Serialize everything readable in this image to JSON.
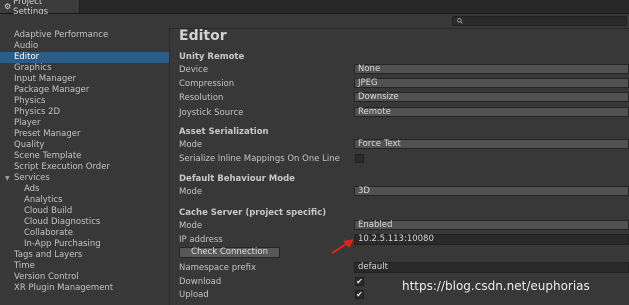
{
  "window": {
    "tab_title": "Project Settings"
  },
  "toolbar": {
    "search_icon": "search-icon"
  },
  "sidebar": {
    "items": [
      {
        "label": "Adaptive Performance",
        "indent": 0
      },
      {
        "label": "Audio",
        "indent": 0
      },
      {
        "label": "Editor",
        "indent": 0,
        "selected": true
      },
      {
        "label": "Graphics",
        "indent": 0
      },
      {
        "label": "Input Manager",
        "indent": 0
      },
      {
        "label": "Package Manager",
        "indent": 0
      },
      {
        "label": "Physics",
        "indent": 0
      },
      {
        "label": "Physics 2D",
        "indent": 0
      },
      {
        "label": "Player",
        "indent": 0
      },
      {
        "label": "Preset Manager",
        "indent": 0
      },
      {
        "label": "Quality",
        "indent": 0
      },
      {
        "label": "Scene Template",
        "indent": 0
      },
      {
        "label": "Script Execution Order",
        "indent": 0
      },
      {
        "label": "Services",
        "indent": 0,
        "foldout": true
      },
      {
        "label": "Ads",
        "indent": 1
      },
      {
        "label": "Analytics",
        "indent": 1
      },
      {
        "label": "Cloud Build",
        "indent": 1
      },
      {
        "label": "Cloud Diagnostics",
        "indent": 1
      },
      {
        "label": "Collaborate",
        "indent": 1
      },
      {
        "label": "In-App Purchasing",
        "indent": 1
      },
      {
        "label": "Tags and Layers",
        "indent": 0
      },
      {
        "label": "Time",
        "indent": 0
      },
      {
        "label": "Version Control",
        "indent": 0
      },
      {
        "label": "XR Plugin Management",
        "indent": 0
      }
    ]
  },
  "editor": {
    "title": "Editor",
    "unity_remote": {
      "header": "Unity Remote",
      "device_label": "Device",
      "device_value": "None",
      "compression_label": "Compression",
      "compression_value": "JPEG",
      "resolution_label": "Resolution",
      "resolution_value": "Downsize",
      "joystick_label": "Joystick Source",
      "joystick_value": "Remote"
    },
    "asset_serialization": {
      "header": "Asset Serialization",
      "mode_label": "Mode",
      "mode_value": "Force Text",
      "inline_label": "Serialize Inline Mappings On One Line",
      "inline_checked": false
    },
    "default_behaviour": {
      "header": "Default Behaviour Mode",
      "mode_label": "Mode",
      "mode_value": "3D"
    },
    "cache_server": {
      "header": "Cache Server (project specific)",
      "mode_label": "Mode",
      "mode_value": "Enabled",
      "ip_label": "IP address",
      "ip_value": "10.2.5.113:10080",
      "check_button": "Check Connection",
      "namespace_label": "Namespace prefix",
      "namespace_value": "default",
      "download_label": "Download",
      "download_checked": true,
      "upload_label": "Upload",
      "upload_checked": true
    }
  },
  "annotation": {
    "arrow_color": "#e0201c"
  },
  "watermark": "https://blog.csdn.net/euphorias"
}
